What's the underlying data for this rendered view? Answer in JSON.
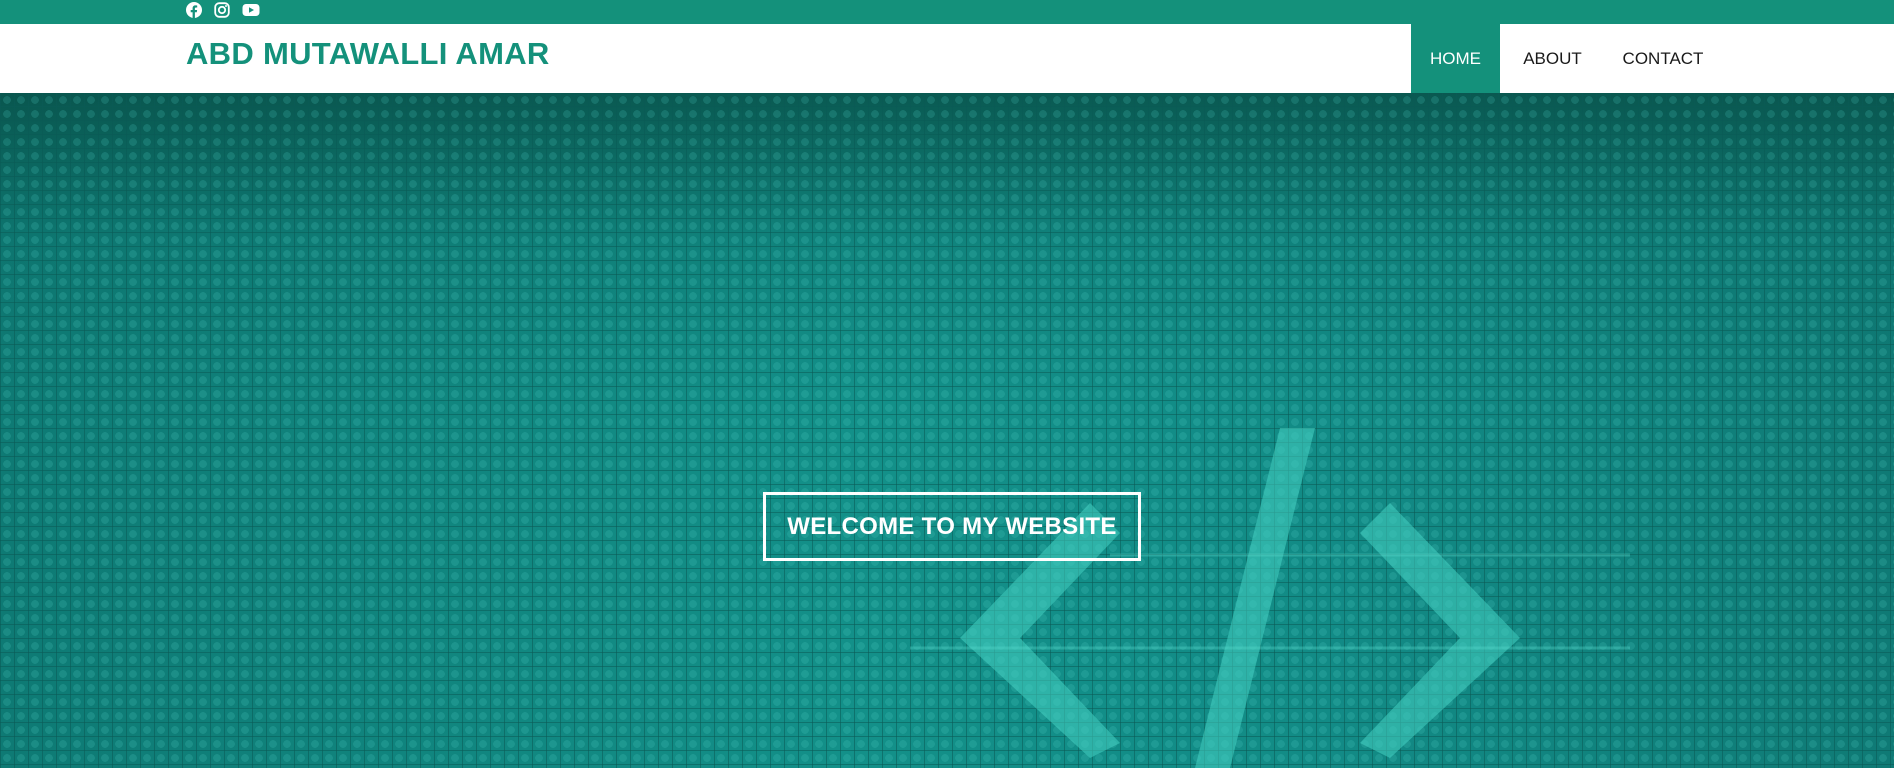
{
  "topbar": {
    "social_icons": [
      "facebook-icon",
      "instagram-icon",
      "youtube-icon"
    ],
    "color": "#14917b"
  },
  "header": {
    "brand": "ABD MUTAWALLI AMAR",
    "brand_color": "#14917b"
  },
  "nav": {
    "items": [
      {
        "label": "HOME",
        "active": true
      },
      {
        "label": "ABOUT",
        "active": false
      },
      {
        "label": "CONTACT",
        "active": false
      }
    ]
  },
  "hero": {
    "welcome_text": "WELCOME TO MY WEBSITE",
    "background_icon": "code-icon"
  }
}
